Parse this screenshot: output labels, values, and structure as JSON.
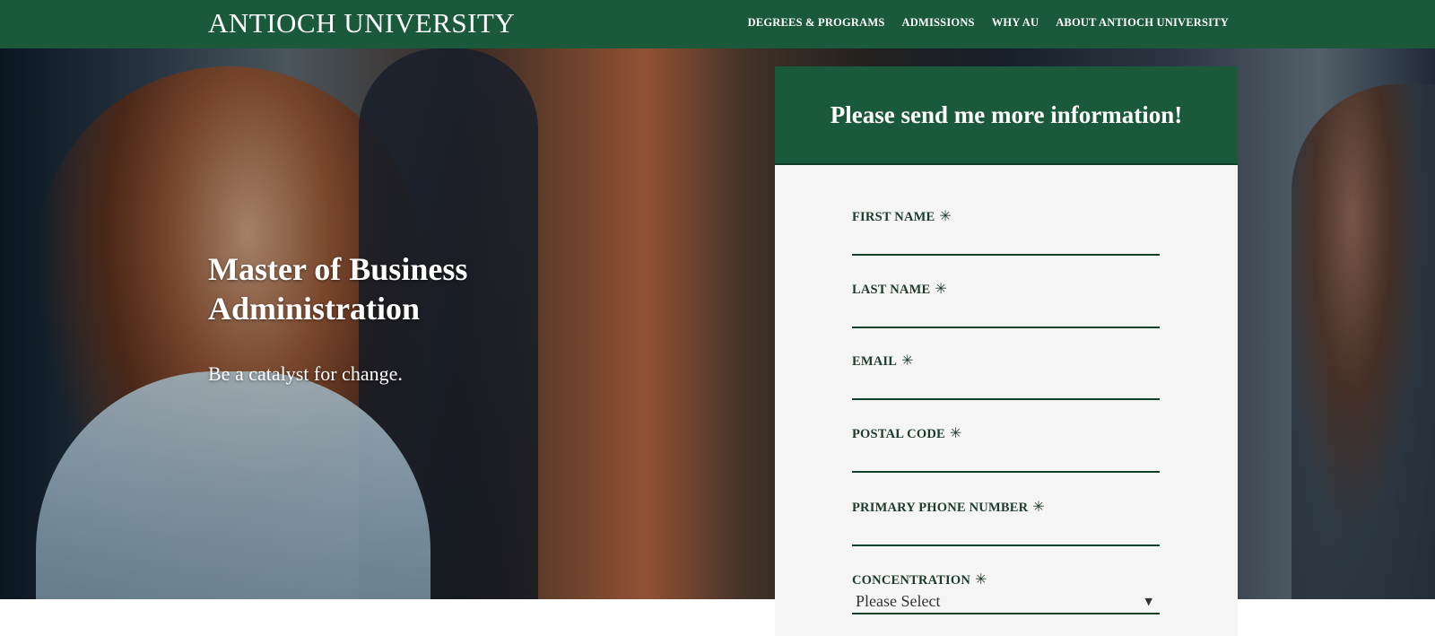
{
  "header": {
    "logo_text": "ANTIOCH UNIVERSITY",
    "nav": [
      {
        "label": "DEGREES & PROGRAMS"
      },
      {
        "label": "ADMISSIONS"
      },
      {
        "label": "WHY AU"
      },
      {
        "label": "ABOUT ANTIOCH UNIVERSITY"
      }
    ]
  },
  "hero": {
    "title": "Master of Business Administration",
    "subtitle": "Be a catalyst for change."
  },
  "form": {
    "heading": "Please send me more information!",
    "required_marker": "✳",
    "fields": [
      {
        "label": "FIRST NAME",
        "value": ""
      },
      {
        "label": "LAST NAME",
        "value": ""
      },
      {
        "label": "EMAIL",
        "value": ""
      },
      {
        "label": "POSTAL CODE",
        "value": ""
      },
      {
        "label": "PRIMARY PHONE NUMBER",
        "value": ""
      }
    ],
    "concentration": {
      "label": "CONCENTRATION",
      "selected": "Please Select"
    }
  },
  "colors": {
    "brand_green": "#1a5a3a",
    "form_bg": "#f4f5f4"
  },
  "icons": {
    "required": "asterisk-icon",
    "dropdown": "chevron-down-icon"
  }
}
